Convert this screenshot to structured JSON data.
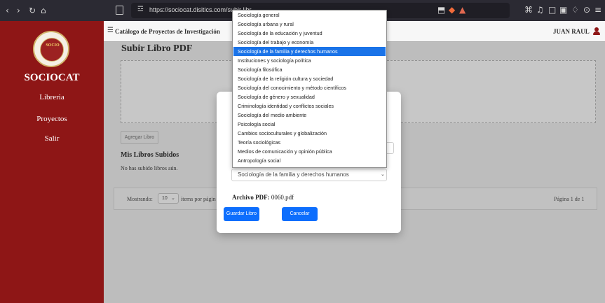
{
  "browser": {
    "url": "https://sociocat.disitics.com/subir libr",
    "nav_icons": [
      "back-icon",
      "forward-icon",
      "reload-icon",
      "home-icon"
    ]
  },
  "sidebar": {
    "brand": "SOCIOCAT",
    "logo_text": "SOCIO",
    "items": [
      {
        "label": "Libreria"
      },
      {
        "label": "Proyectos"
      },
      {
        "label": "Salir"
      }
    ]
  },
  "header": {
    "title": "Catálogo de Proyectos de Investigación",
    "user": "JUAN RAUL"
  },
  "main": {
    "page_title": "Subir Libro PDF",
    "add_button": "Agregar Libro",
    "my_books_title": "Mis Libros Subidos",
    "no_books": "No has subido libros aún.",
    "showing_label": "Mostrando:",
    "per_page": "10",
    "items_label": "ítems por págin",
    "page_info": "Página 1 de 1"
  },
  "modal": {
    "selected_category": "Sociología de la familia y derechos humanos",
    "pdf_label": "Archivo PDF:",
    "pdf_name": "0060.pdf",
    "save_button": "Guardar Libro",
    "cancel_button": "Cancelar"
  },
  "dropdown": {
    "options": [
      "Sociología general",
      "Sociología urbana y rural",
      "Sociología de la educación y juventud",
      "Sociología del trabajo y economía",
      "Sociología de la familia y derechos humanos",
      "Instituciones y sociología política",
      "Sociología filosófica",
      "Sociología de la religión cultura y sociedad",
      "Sociología del conocimiento y método científicos",
      "Sociología de género y sexualidad",
      "Criminología identidad y conflictos sociales",
      "Sociología del medio ambiente",
      "Psicología social",
      "Cambios socioculturales y globalización",
      "Teoría sociológicas",
      "Medios de comunicación y opinión pública",
      "Antropología social"
    ],
    "selected": "Sociología de la familia y derechos humanos"
  }
}
